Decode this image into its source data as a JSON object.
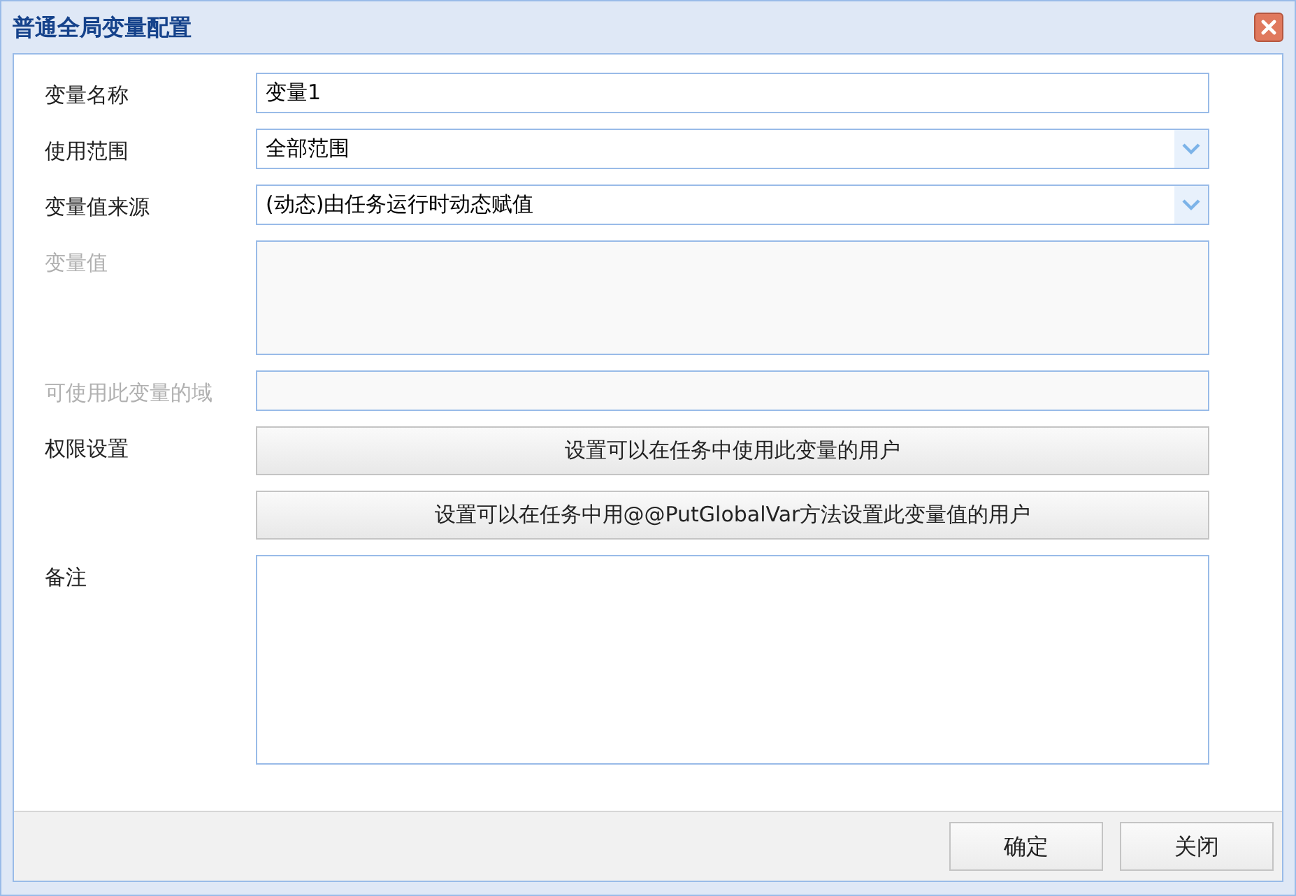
{
  "window": {
    "title": "普通全局变量配置"
  },
  "fields": [
    {
      "kind": "text",
      "label": "变量名称",
      "value": "变量1",
      "disabled": false
    },
    {
      "kind": "select",
      "label": "使用范围",
      "value": "全部范围",
      "disabled": false
    },
    {
      "kind": "select",
      "label": "变量值来源",
      "value": "(动态)由任务运行时动态赋值",
      "disabled": false
    },
    {
      "kind": "textarea",
      "label": "变量值",
      "disabled": true
    },
    {
      "kind": "text",
      "label": "可使用此变量的域",
      "disabled": true
    },
    {
      "kind": "button",
      "label": "权限设置",
      "text": "设置可以在任务中使用此变量的用户"
    },
    {
      "kind": "button",
      "text": "设置可以在任务中用@@PutGlobalVar方法设置此变量值的用户"
    },
    {
      "kind": "textarea",
      "label": "备注",
      "disabled": false
    }
  ],
  "buttons": [
    "确定",
    "关闭"
  ]
}
